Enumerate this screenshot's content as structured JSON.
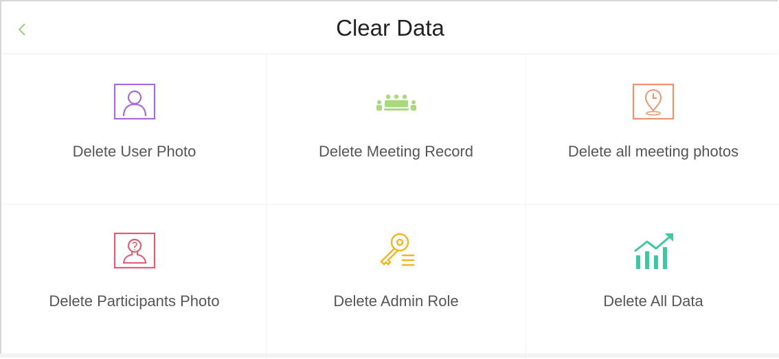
{
  "header": {
    "title": "Clear Data",
    "back_icon": "chevron-left-icon",
    "accent_color": "#7ccf5e"
  },
  "tiles": [
    {
      "label": "Delete User Photo",
      "icon": "user-portrait-icon",
      "color": "#a56ae0"
    },
    {
      "label": "Delete Meeting Record",
      "icon": "meeting-group-icon",
      "color": "#a8d97a"
    },
    {
      "label": "Delete all meeting photos",
      "icon": "location-clock-icon",
      "color": "#f0936a"
    },
    {
      "label": "Delete Participants Photo",
      "icon": "participant-question-icon",
      "color": "#e45a73"
    },
    {
      "label": "Delete Admin Role",
      "icon": "key-list-icon",
      "color": "#f2b51e"
    },
    {
      "label": "Delete All Data",
      "icon": "bar-chart-trend-icon",
      "color": "#3cc8a0"
    }
  ]
}
